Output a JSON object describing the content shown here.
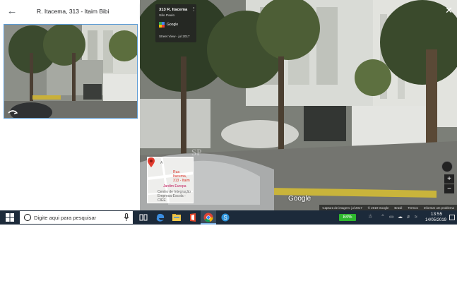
{
  "place_panel": {
    "title": "R. Itacema, 313 - Itaim Bibi"
  },
  "street_view": {
    "card": {
      "address": "313 R. Itacema",
      "city": "São Paulo",
      "provider": "Google",
      "date": "Street View - jul 2017"
    },
    "watermark": "SP",
    "logo_text": "Google",
    "mini_map": {
      "street_letter": "A",
      "place_label": "Rua Itacema, 313 - Itaim",
      "area_label": "Jardim Europa",
      "poi_label": "Centro de Integração Empresa-Escola - CIEE"
    },
    "footer": {
      "capture": "Captura de imagem: jul 2017",
      "copyright": "© 2019 Google",
      "country": "Brasil",
      "terms": "Termos",
      "report": "Informar um problema"
    },
    "zoom_in": "+",
    "zoom_out": "−",
    "close": "✕"
  },
  "taskbar": {
    "search_placeholder": "Digite aqui para pesquisar",
    "battery": "84%",
    "time": "13:55",
    "date": "14/05/2019"
  },
  "icons": {
    "back": "arrow-left-icon",
    "rotate": "rotate-icon",
    "start": "windows-icon",
    "search": "cortana-icon",
    "mic": "microphone-icon"
  },
  "colors": {
    "taskbar": "#1c2a3a",
    "preview_border": "#5b9bd5",
    "battery": "#2eb82e"
  }
}
